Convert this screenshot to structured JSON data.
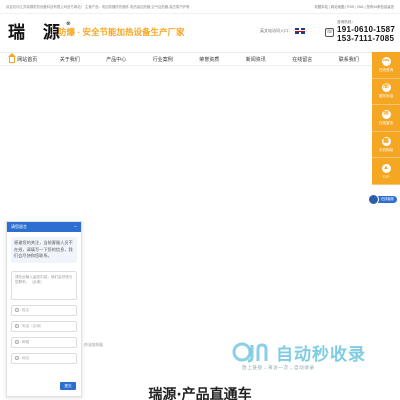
{
  "topbar": {
    "left": "欢迎访问江苏瑞源防热设备科技有限公司官方网站！ 主营产品：电加热器防热器件,电热油加热器,空气加热器,高压蒸汽炉等",
    "right": "收藏本站 | 网站地图 | RSS | XML | 您有34条信息留言"
  },
  "header": {
    "logo": "瑞 源",
    "logo_mark": "®",
    "slogan": "防爆 · 安全节能加热设备生产厂家",
    "lang_label": "英文站访问入口：",
    "phone_label": "咨询热线：",
    "phone1": "191-0610-1587",
    "phone2": "153-7111-7085"
  },
  "nav": {
    "items": [
      "网站首页",
      "关于我们",
      "产品中心",
      "行业案例",
      "荣誉资质",
      "新闻资讯",
      "在线留言",
      "联系我们"
    ]
  },
  "rail": {
    "items": [
      {
        "label": "在线咨询",
        "icon": "chat-icon"
      },
      {
        "label": "服务电话",
        "icon": "phone-icon"
      },
      {
        "label": "在线留言",
        "icon": "message-icon"
      },
      {
        "label": "手机网站",
        "icon": "qr-icon"
      },
      {
        "label": "TOP",
        "icon": "arrow-up-icon"
      }
    ]
  },
  "online": {
    "label": "在线客服"
  },
  "chat": {
    "title": "请您留言",
    "close": "−",
    "message": "感谢您的关注，当前客服人员不在线，请填写一下您的信息，我们会尽快和您联系。",
    "textarea_placeholder": "请在此输入留言内容，我们会尽快与您联系。（必填）",
    "fields": [
      "姓名",
      "电话（必填）",
      "邮箱",
      "地址"
    ],
    "submit": "提交"
  },
  "background_text": "热油加热器",
  "watermark": {
    "title": "自动秒收录",
    "subtitle": "放上链接→来访一次→自动收录"
  },
  "section": {
    "title": "瑞源·产品直通车"
  },
  "colors": {
    "accent": "#f5a623",
    "chat_blue": "#2c6fd1",
    "watermark": "#6bc4dd"
  }
}
